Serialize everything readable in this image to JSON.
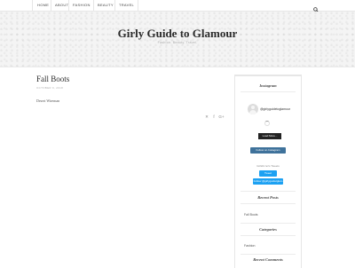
{
  "nav": {
    "items": [
      "HOME",
      "ABOUT",
      "FASHION",
      "BEAUTY",
      "TRAVEL"
    ]
  },
  "header": {
    "title": "Girly Guide to Glamour",
    "tagline": "Fashion. Beauty. Travel."
  },
  "post": {
    "title": "Fall Boots",
    "date": "OCTOBER 9, 2018",
    "author": "Desert Wireman",
    "share_icons": [
      "twitter-icon",
      "facebook-icon",
      "google-plus-icon"
    ],
    "share_glyphs": [
      "✕",
      "f",
      "G+"
    ]
  },
  "sidebar": {
    "instagram": {
      "title": "Instagram",
      "handle": "@girlyguidetoglamour",
      "load_more": "Load More...",
      "follow": "Follow on Instagram"
    },
    "twitter": {
      "label": "Girlsfix let's Tweets",
      "tweet": "Tweet",
      "follow": "Follow @girlyguidetglam"
    },
    "recent_posts": {
      "title": "Recent Posts",
      "items": [
        "Fall Boots"
      ]
    },
    "categories": {
      "title": "Categories",
      "items": [
        "Fashion"
      ]
    },
    "recent_comments": {
      "title": "Recent Comments"
    }
  },
  "colors": {
    "twitter_blue": "#1da1f2",
    "instagram_blue": "#3f729b"
  }
}
